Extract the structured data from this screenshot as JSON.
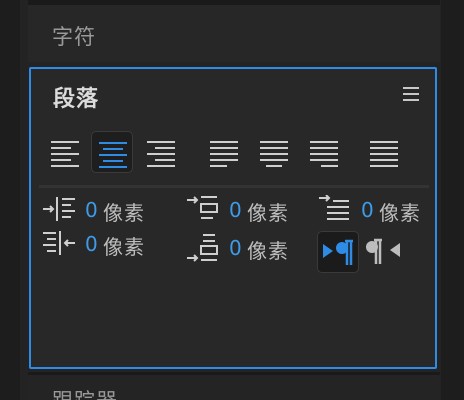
{
  "sections": {
    "character": {
      "title": "字符"
    },
    "paragraph": {
      "title": "段落"
    },
    "tracker": {
      "title": "跟踪器"
    }
  },
  "paragraph": {
    "menu_icon": "hamburger-menu-icon",
    "alignment_buttons": [
      {
        "name": "align-left",
        "active": false
      },
      {
        "name": "align-center",
        "active": true
      },
      {
        "name": "align-right",
        "active": false
      },
      {
        "name": "justify-last-left",
        "active": false
      },
      {
        "name": "justify-last-center",
        "active": false
      },
      {
        "name": "justify-last-right",
        "active": false
      },
      {
        "name": "justify-all",
        "active": false
      }
    ],
    "fields": {
      "indent_left": {
        "value": "0",
        "unit": "像素"
      },
      "space_before": {
        "value": "0",
        "unit": "像素"
      },
      "first_line_indent": {
        "value": "0",
        "unit": "像素"
      },
      "indent_right": {
        "value": "0",
        "unit": "像素"
      },
      "space_after": {
        "value": "0",
        "unit": "像素"
      }
    },
    "direction": {
      "ltr_active": true
    }
  },
  "colors": {
    "accent": "#2f8ce6",
    "value_blue": "#3d9be9",
    "panel_bg": "#282828"
  }
}
